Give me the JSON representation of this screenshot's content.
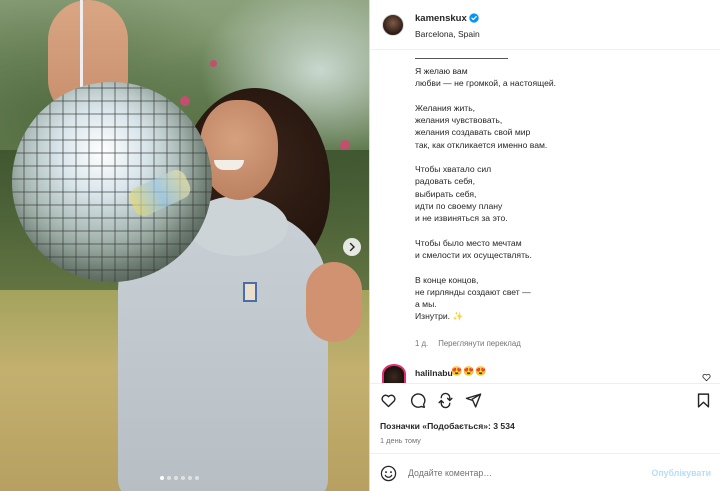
{
  "post": {
    "username": "kamenskux",
    "location": "Barcelona, Spain",
    "caption_paragraphs": [
      "Я желаю вам\nлюбви — не громкой, а настоящей.",
      "Желания жить,\nжелания чувствовать,\nжелания создавать свой мир\nтак, как откликается именно вам.",
      "Чтобы хватало сил\nрадовать себя,\nвыбирать себя,\nидти по своему плану\nи не извиняться за это.",
      "Чтобы было место мечтам\nи смелости их осуществлять.",
      "В конце концов,\nне гирлянды создают свет —\nа мы.\nИзнутри."
    ],
    "caption_sparkle": "✨",
    "age": "1 д.",
    "translate_label": "Переглянути переклад",
    "likes_label": "Позначки «Подобається»: 3 534",
    "time_label": "1 день тому"
  },
  "comment": {
    "username": "halilnabu",
    "text": "😍😍😍"
  },
  "composer": {
    "placeholder": "Додайте коментар…",
    "publish_label": "Опублікувати"
  },
  "carousel": {
    "slides_count": 6,
    "active_index": 0
  },
  "colors": {
    "verified": "#0095f6",
    "publish_disabled": "#b2dffc",
    "secondary_text": "#737373"
  },
  "icons": {
    "like": "heart-icon",
    "comment": "comment-icon",
    "repost": "repost-icon",
    "share": "share-icon",
    "save": "bookmark-icon",
    "emoji": "emoji-icon",
    "next": "chevron-right-icon"
  }
}
